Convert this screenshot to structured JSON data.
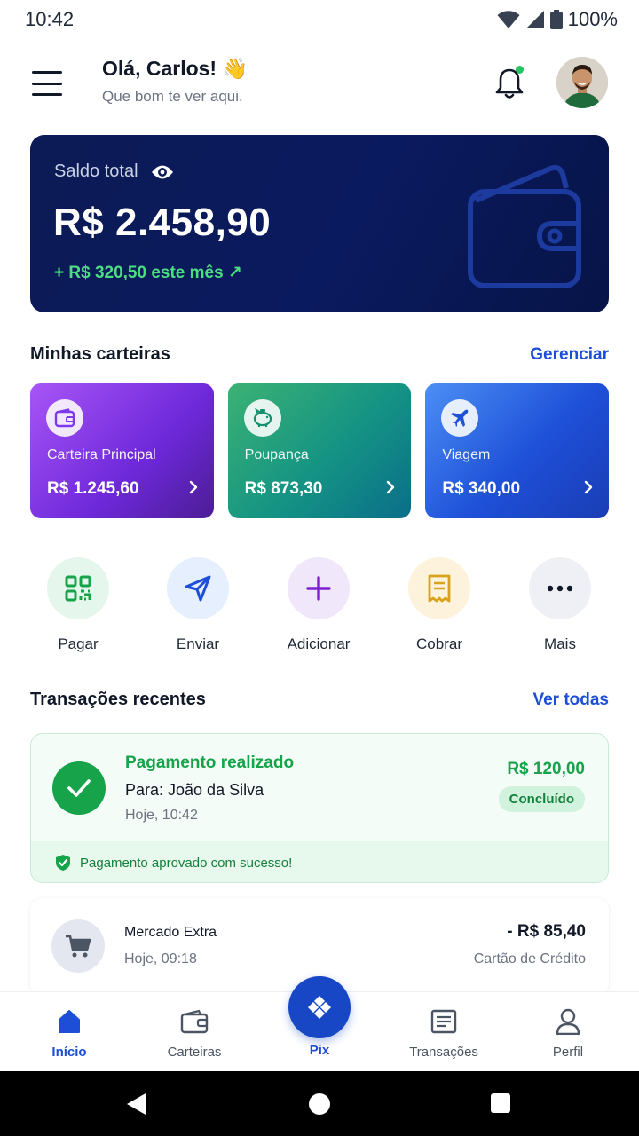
{
  "status_bar": {
    "time": "10:42",
    "battery": "100%"
  },
  "header": {
    "greeting": "Olá, Carlos! 👋",
    "subtitle": "Que bom te ver aqui."
  },
  "balance": {
    "label": "Saldo total",
    "value": "R$ 2.458,90",
    "monthly_change": "+ R$ 320,50 este mês ↗"
  },
  "wallets_section": {
    "title": "Minhas carteiras",
    "link": "Gerenciar",
    "items": [
      {
        "name": "Carteira Principal",
        "value": "R$ 1.245,60",
        "icon": "wallet-icon"
      },
      {
        "name": "Poupança",
        "value": "R$ 873,30",
        "icon": "piggy-bank-icon"
      },
      {
        "name": "Viagem",
        "value": "R$ 340,00",
        "icon": "airplane-icon"
      }
    ]
  },
  "quick_actions": [
    {
      "label": "Pagar",
      "icon": "qr-code-icon",
      "color": "#16a34a"
    },
    {
      "label": "Enviar",
      "icon": "send-icon",
      "color": "#1d4ed8"
    },
    {
      "label": "Adicionar",
      "icon": "plus-icon",
      "color": "#7e22ce"
    },
    {
      "label": "Cobrar",
      "icon": "receipt-icon",
      "color": "#d9a21b"
    },
    {
      "label": "Mais",
      "icon": "more-icon",
      "color": "#111827"
    }
  ],
  "transactions_section": {
    "title": "Transações recentes",
    "link": "Ver todas",
    "items": [
      {
        "title": "Pagamento realizado",
        "recipient": "Para: João da Silva",
        "time": "Hoje, 10:42",
        "amount": "R$ 120,00",
        "status": "Concluído",
        "note": "Pagamento aprovado com sucesso!"
      },
      {
        "title": "Mercado Extra",
        "time": "Hoje, 09:18",
        "amount": "- R$ 85,40",
        "method": "Cartão de Crédito"
      }
    ]
  },
  "bottom_nav": {
    "items": [
      {
        "label": "Início",
        "active": true
      },
      {
        "label": "Carteiras",
        "active": false
      },
      {
        "label": "Pix",
        "active": false
      },
      {
        "label": "Transações",
        "active": false
      },
      {
        "label": "Perfil",
        "active": false
      }
    ]
  },
  "colors": {
    "primary": "#1d4ed8",
    "success": "#16a34a",
    "balance_card": "#0a1a5e"
  }
}
